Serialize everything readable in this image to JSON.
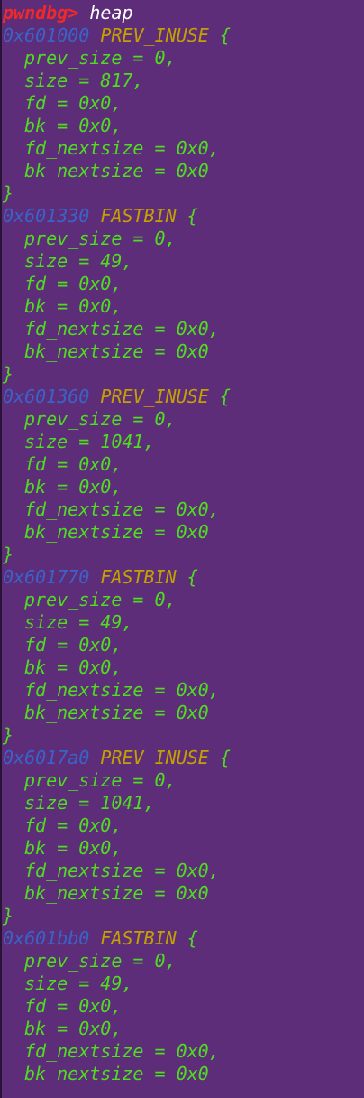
{
  "colors": {
    "background": "#5e2d79",
    "prompt": "#ef2929",
    "address": "#3a63c9",
    "chunk_type": "#c4a000",
    "field_text": "#4fdc21",
    "command": "#ffffff"
  },
  "prompt": {
    "label": "pwndbg>",
    "command": " heap"
  },
  "chunks": [
    {
      "address": "0x601000",
      "type": "PREV_INUSE",
      "open": " {",
      "fields": [
        "prev_size = 0,",
        "size = 817,",
        "fd = 0x0,",
        "bk = 0x0,",
        "fd_nextsize = 0x0,",
        "bk_nextsize = 0x0"
      ],
      "close": "}"
    },
    {
      "address": "0x601330",
      "type": "FASTBIN",
      "open": " {",
      "fields": [
        "prev_size = 0,",
        "size = 49,",
        "fd = 0x0,",
        "bk = 0x0,",
        "fd_nextsize = 0x0,",
        "bk_nextsize = 0x0"
      ],
      "close": "}"
    },
    {
      "address": "0x601360",
      "type": "PREV_INUSE",
      "open": " {",
      "fields": [
        "prev_size = 0,",
        "size = 1041,",
        "fd = 0x0,",
        "bk = 0x0,",
        "fd_nextsize = 0x0,",
        "bk_nextsize = 0x0"
      ],
      "close": "}"
    },
    {
      "address": "0x601770",
      "type": "FASTBIN",
      "open": " {",
      "fields": [
        "prev_size = 0,",
        "size = 49,",
        "fd = 0x0,",
        "bk = 0x0,",
        "fd_nextsize = 0x0,",
        "bk_nextsize = 0x0"
      ],
      "close": "}"
    },
    {
      "address": "0x6017a0",
      "type": "PREV_INUSE",
      "open": " {",
      "fields": [
        "prev_size = 0,",
        "size = 1041,",
        "fd = 0x0,",
        "bk = 0x0,",
        "fd_nextsize = 0x0,",
        "bk_nextsize = 0x0"
      ],
      "close": "}"
    },
    {
      "address": "0x601bb0",
      "type": "FASTBIN",
      "open": " {",
      "fields": [
        "prev_size = 0,",
        "size = 49,",
        "fd = 0x0,",
        "bk = 0x0,",
        "fd_nextsize = 0x0,",
        "bk_nextsize = 0x0"
      ],
      "close": null
    }
  ]
}
